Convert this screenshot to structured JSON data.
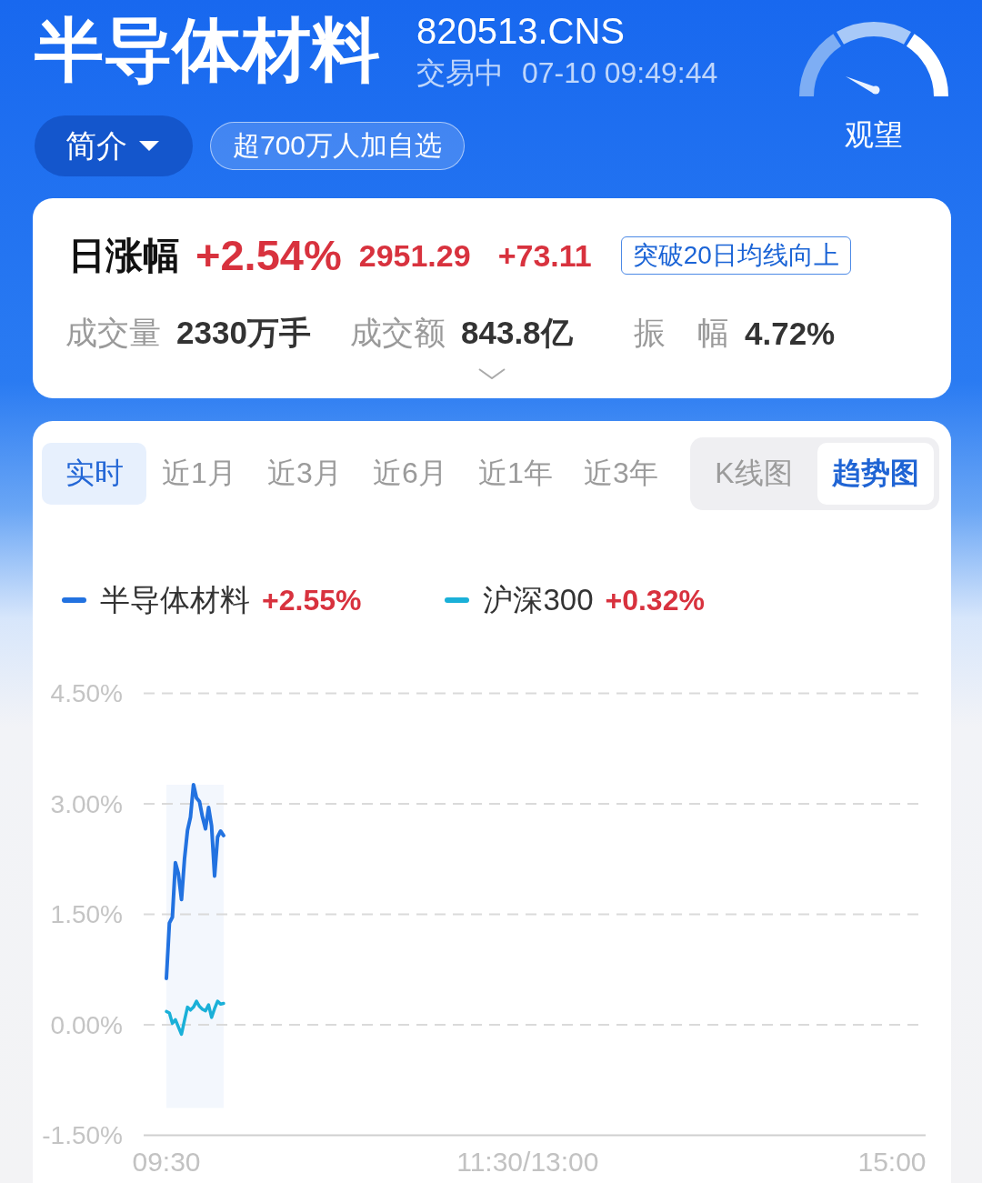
{
  "header": {
    "title": "半导体材料",
    "code": "820513.CNS",
    "status": "交易中",
    "timestamp": "07-10 09:49:44",
    "intro_button": "简介",
    "watchlist_badge": "超700万人加自选",
    "sentiment": "观望"
  },
  "stats": {
    "change_label": "日涨幅",
    "change_percent": "+2.54%",
    "price": "2951.29",
    "change": "+73.11",
    "signal_tag": "突破20日均线向上",
    "items": [
      {
        "label": "成交量",
        "value": "2330万手"
      },
      {
        "label": "成交额",
        "value": "843.8亿"
      },
      {
        "label": "振　幅",
        "value": "4.72%"
      }
    ],
    "expanded": false
  },
  "chart": {
    "periods": [
      {
        "label": "实时",
        "selected": true
      },
      {
        "label": "近1月",
        "selected": false
      },
      {
        "label": "近3月",
        "selected": false
      },
      {
        "label": "近6月",
        "selected": false
      },
      {
        "label": "近1年",
        "selected": false
      },
      {
        "label": "近3年",
        "selected": false
      }
    ],
    "chart_types": [
      {
        "label": "K线图",
        "selected": false
      },
      {
        "label": "趋势图",
        "selected": true
      }
    ],
    "legend_values": [
      "+2.55%",
      "+0.32%"
    ],
    "chart_data": {
      "type": "line",
      "grid": true,
      "legend": true,
      "categories": [
        "09:30",
        null,
        null,
        null,
        null,
        null,
        null,
        null,
        null,
        null,
        null,
        null,
        null,
        null,
        null,
        null,
        null,
        null,
        null,
        null,
        null,
        null,
        null,
        null,
        null,
        null,
        null,
        null,
        null,
        null,
        null,
        null,
        null,
        null,
        null,
        null,
        null,
        null,
        null,
        null,
        null,
        null,
        null,
        null,
        null,
        null,
        null,
        null,
        null,
        null,
        null,
        null,
        null,
        null,
        null,
        null,
        null,
        null,
        null,
        null,
        null,
        null,
        null,
        null,
        null,
        null,
        null,
        null,
        null,
        null,
        null,
        null,
        null,
        null,
        null,
        null,
        null,
        null,
        null,
        null,
        null,
        null,
        null,
        null,
        null,
        null,
        null,
        null,
        null,
        null,
        null,
        null,
        null,
        null,
        null,
        null,
        null,
        null,
        null,
        null,
        null,
        null,
        null,
        null,
        null,
        null,
        null,
        null,
        null,
        null,
        null,
        null,
        null,
        null,
        null,
        null,
        null,
        null,
        null,
        null,
        "11:30/13:00",
        null,
        null,
        null,
        null,
        null,
        null,
        null,
        null,
        null,
        null,
        null,
        null,
        null,
        null,
        null,
        null,
        null,
        null,
        null,
        null,
        null,
        null,
        null,
        null,
        null,
        null,
        null,
        null,
        null,
        null,
        null,
        null,
        null,
        null,
        null,
        null,
        null,
        null,
        null,
        null,
        null,
        null,
        null,
        null,
        null,
        null,
        null,
        null,
        null,
        null,
        null,
        null,
        null,
        null,
        null,
        null,
        null,
        null,
        null,
        null,
        null,
        null,
        null,
        null,
        null,
        null,
        null,
        null,
        null,
        null,
        null,
        null,
        null,
        null,
        null,
        null,
        null,
        null,
        null,
        null,
        null,
        null,
        null,
        null,
        null,
        null,
        null,
        null,
        null,
        null,
        null,
        null,
        null,
        null,
        null,
        null,
        null,
        null,
        null,
        null,
        null,
        null,
        null,
        null,
        null,
        null,
        null,
        null,
        null,
        null,
        null,
        null,
        null,
        null,
        null,
        null,
        null,
        null,
        null,
        null,
        "15:00"
      ],
      "ylim": [
        -1.5,
        4.5
      ],
      "yticks": [
        {
          "value": 4.5,
          "label": "4.50%"
        },
        {
          "value": 3,
          "label": "3.00%"
        },
        {
          "value": 1.5,
          "label": "1.50%"
        },
        {
          "value": 0,
          "label": "0.00%"
        },
        {
          "value": -1.5,
          "label": "-1.50%"
        }
      ],
      "series": [
        {
          "name": "半导体材料",
          "color": "#2272e0",
          "values": [
            0.63,
            1.38,
            1.46,
            2.2,
            2.05,
            1.7,
            2.25,
            2.64,
            2.82,
            3.26,
            3.08,
            3.03,
            2.82,
            2.66,
            2.95,
            2.7,
            2.02,
            2.55,
            2.63,
            2.57,
            null,
            null,
            null,
            null,
            null,
            null,
            null,
            null,
            null,
            null,
            null,
            null,
            null,
            null,
            null,
            null,
            null,
            null,
            null,
            null,
            null,
            null,
            null,
            null,
            null,
            null,
            null,
            null,
            null,
            null,
            null,
            null,
            null,
            null,
            null,
            null,
            null,
            null,
            null,
            null,
            null,
            null,
            null,
            null,
            null,
            null,
            null,
            null,
            null,
            null,
            null,
            null,
            null,
            null,
            null,
            null,
            null,
            null,
            null,
            null,
            null,
            null,
            null,
            null,
            null,
            null,
            null,
            null,
            null,
            null,
            null,
            null,
            null,
            null,
            null,
            null,
            null,
            null,
            null,
            null,
            null,
            null,
            null,
            null,
            null,
            null,
            null,
            null,
            null,
            null,
            null,
            null,
            null,
            null,
            null,
            null,
            null,
            null,
            null,
            null,
            null,
            null,
            null,
            null,
            null,
            null,
            null,
            null,
            null,
            null,
            null,
            null,
            null,
            null,
            null,
            null,
            null,
            null,
            null,
            null,
            null,
            null,
            null,
            null,
            null,
            null,
            null,
            null,
            null,
            null,
            null,
            null,
            null,
            null,
            null,
            null,
            null,
            null,
            null,
            null,
            null,
            null,
            null,
            null,
            null,
            null,
            null,
            null,
            null,
            null,
            null,
            null,
            null,
            null,
            null,
            null,
            null,
            null,
            null,
            null,
            null,
            null,
            null,
            null,
            null,
            null,
            null,
            null,
            null,
            null,
            null,
            null,
            null,
            null,
            null,
            null,
            null,
            null,
            null,
            null,
            null,
            null,
            null,
            null,
            null,
            null,
            null,
            null,
            null,
            null,
            null,
            null,
            null,
            null,
            null,
            null,
            null,
            null,
            null,
            null,
            null,
            null,
            null,
            null,
            null,
            null,
            null,
            null,
            null,
            null,
            null,
            null,
            null,
            null,
            null,
            null,
            null,
            null,
            null,
            null,
            null,
            null
          ]
        },
        {
          "name": "沪深300",
          "color": "#1ab0d8",
          "values": [
            0.18,
            0.16,
            0.02,
            0.07,
            -0.03,
            -0.13,
            0.06,
            0.24,
            0.2,
            0.24,
            0.32,
            0.25,
            0.21,
            0.19,
            0.27,
            0.1,
            0.22,
            0.32,
            0.28,
            0.29,
            null,
            null,
            null,
            null,
            null,
            null,
            null,
            null,
            null,
            null,
            null,
            null,
            null,
            null,
            null,
            null,
            null,
            null,
            null,
            null,
            null,
            null,
            null,
            null,
            null,
            null,
            null,
            null,
            null,
            null,
            null,
            null,
            null,
            null,
            null,
            null,
            null,
            null,
            null,
            null,
            null,
            null,
            null,
            null,
            null,
            null,
            null,
            null,
            null,
            null,
            null,
            null,
            null,
            null,
            null,
            null,
            null,
            null,
            null,
            null,
            null,
            null,
            null,
            null,
            null,
            null,
            null,
            null,
            null,
            null,
            null,
            null,
            null,
            null,
            null,
            null,
            null,
            null,
            null,
            null,
            null,
            null,
            null,
            null,
            null,
            null,
            null,
            null,
            null,
            null,
            null,
            null,
            null,
            null,
            null,
            null,
            null,
            null,
            null,
            null,
            null,
            null,
            null,
            null,
            null,
            null,
            null,
            null,
            null,
            null,
            null,
            null,
            null,
            null,
            null,
            null,
            null,
            null,
            null,
            null,
            null,
            null,
            null,
            null,
            null,
            null,
            null,
            null,
            null,
            null,
            null,
            null,
            null,
            null,
            null,
            null,
            null,
            null,
            null,
            null,
            null,
            null,
            null,
            null,
            null,
            null,
            null,
            null,
            null,
            null,
            null,
            null,
            null,
            null,
            null,
            null,
            null,
            null,
            null,
            null,
            null,
            null,
            null,
            null,
            null,
            null,
            null,
            null,
            null,
            null,
            null,
            null,
            null,
            null,
            null,
            null,
            null,
            null,
            null,
            null,
            null,
            null,
            null,
            null,
            null,
            null,
            null,
            null,
            null,
            null,
            null,
            null,
            null,
            null,
            null,
            null,
            null,
            null,
            null,
            null,
            null,
            null,
            null,
            null,
            null,
            null,
            null,
            null,
            null,
            null,
            null,
            null,
            null,
            null,
            null,
            null,
            null,
            null,
            null,
            null,
            null,
            null
          ]
        }
      ]
    }
  }
}
